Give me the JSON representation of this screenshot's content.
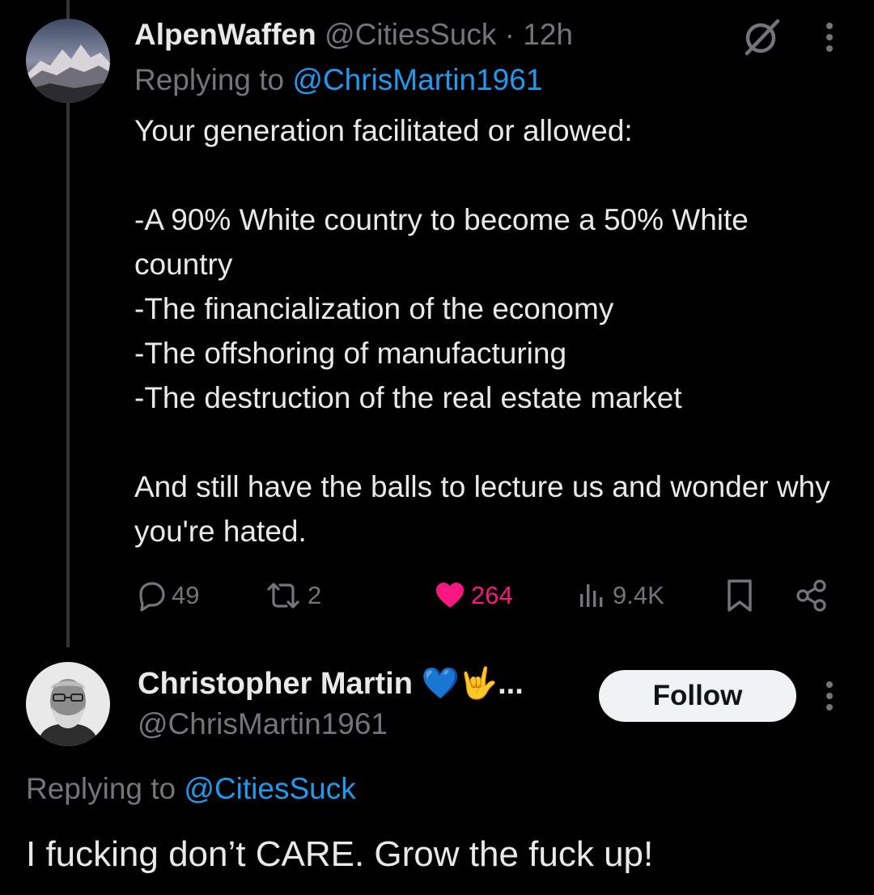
{
  "tweet1": {
    "display_name": "AlpenWaffen",
    "handle": "@CitiesSuck",
    "separator": "·",
    "time": "12h",
    "replying_prefix": "Replying to",
    "replying_to": "@ChrisMartin1961",
    "paragraphs": [
      "Your generation facilitated or allowed:",
      "-A 90% White country to become a 50% White country\n-The financialization of the economy\n-The offshoring of manufacturing\n-The destruction of the real estate market",
      "And still have the balls to lecture us and wonder why you're hated."
    ],
    "replies": "49",
    "reposts": "2",
    "likes": "264",
    "views": "9.4K"
  },
  "tweet2": {
    "display_name": "Christopher Martin",
    "emojis": "💙🤟",
    "ellipsis": "...",
    "handle": "@ChrisMartin1961",
    "follow_label": "Follow",
    "replying_prefix": "Replying to",
    "replying_to": "@CitiesSuck",
    "text": "I fucking don’t CARE.  Grow the fuck up!"
  },
  "colors": {
    "background": "#000000",
    "text": "#e7e9ea",
    "muted": "#71767b",
    "link": "#1d9bf0",
    "like": "#f91880"
  }
}
